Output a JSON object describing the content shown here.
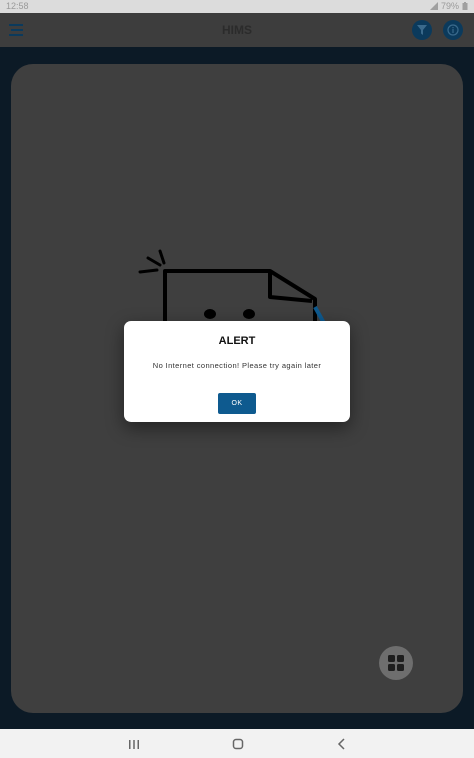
{
  "status_bar": {
    "time": "12:58",
    "battery": "79%"
  },
  "app_bar": {
    "title": "HIMS"
  },
  "dialog": {
    "title": "ALERT",
    "message": "No Internet connection! Please try again later",
    "ok_label": "OK"
  },
  "colors": {
    "primary": "#0e5a8f",
    "app_bar_dark": "#0b3a5c",
    "card": "#3f3f3f",
    "background": "#0c1a26"
  },
  "icons": {
    "menu": "menu-icon",
    "filter": "filter-icon",
    "info": "info-icon",
    "fab": "grid-icon",
    "nav_recents": "recents-icon",
    "nav_home": "home-icon",
    "nav_back": "back-icon"
  }
}
